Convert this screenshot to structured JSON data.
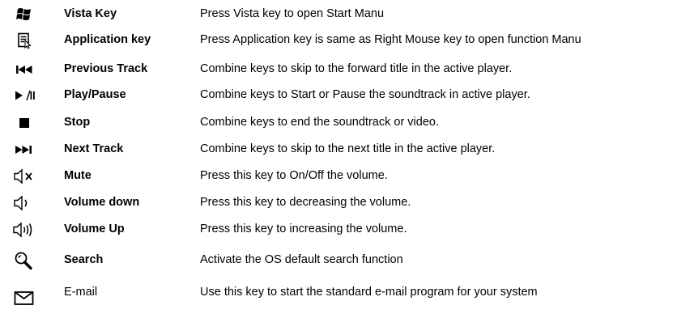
{
  "keys": [
    {
      "icon": "windows-logo-icon",
      "name": "Vista Key",
      "desc": "Press Vista key to open Start Manu"
    },
    {
      "icon": "application-menu-icon",
      "name": "Application key",
      "desc": "Press Application key is same as Right Mouse key to open function Manu"
    },
    {
      "icon": "previous-track-icon",
      "name": "Previous Track",
      "desc": "Combine keys to skip to the forward title in the active player."
    },
    {
      "icon": "play-pause-icon",
      "name": "Play/Pause",
      "desc": "Combine keys to Start or Pause the soundtrack in active player."
    },
    {
      "icon": "stop-icon",
      "name": "Stop",
      "desc": "Combine keys to end the soundtrack or video."
    },
    {
      "icon": "next-track-icon",
      "name": "Next Track",
      "desc": "Combine keys to skip to the next title in the active player."
    },
    {
      "icon": "mute-icon",
      "name": "Mute",
      "desc": "Press this key to On/Off the volume."
    },
    {
      "icon": "volume-down-icon",
      "name": "Volume down",
      "desc": "Press this key to decreasing the volume."
    },
    {
      "icon": "volume-up-icon",
      "name": "Volume Up",
      "desc": "Press this key to increasing the volume."
    },
    {
      "icon": "search-icon",
      "name": "Search",
      "desc": "Activate the OS default search function"
    },
    {
      "icon": "email-icon",
      "name": "E-mail",
      "desc": "Use this key to start the standard e-mail program for your system"
    }
  ]
}
